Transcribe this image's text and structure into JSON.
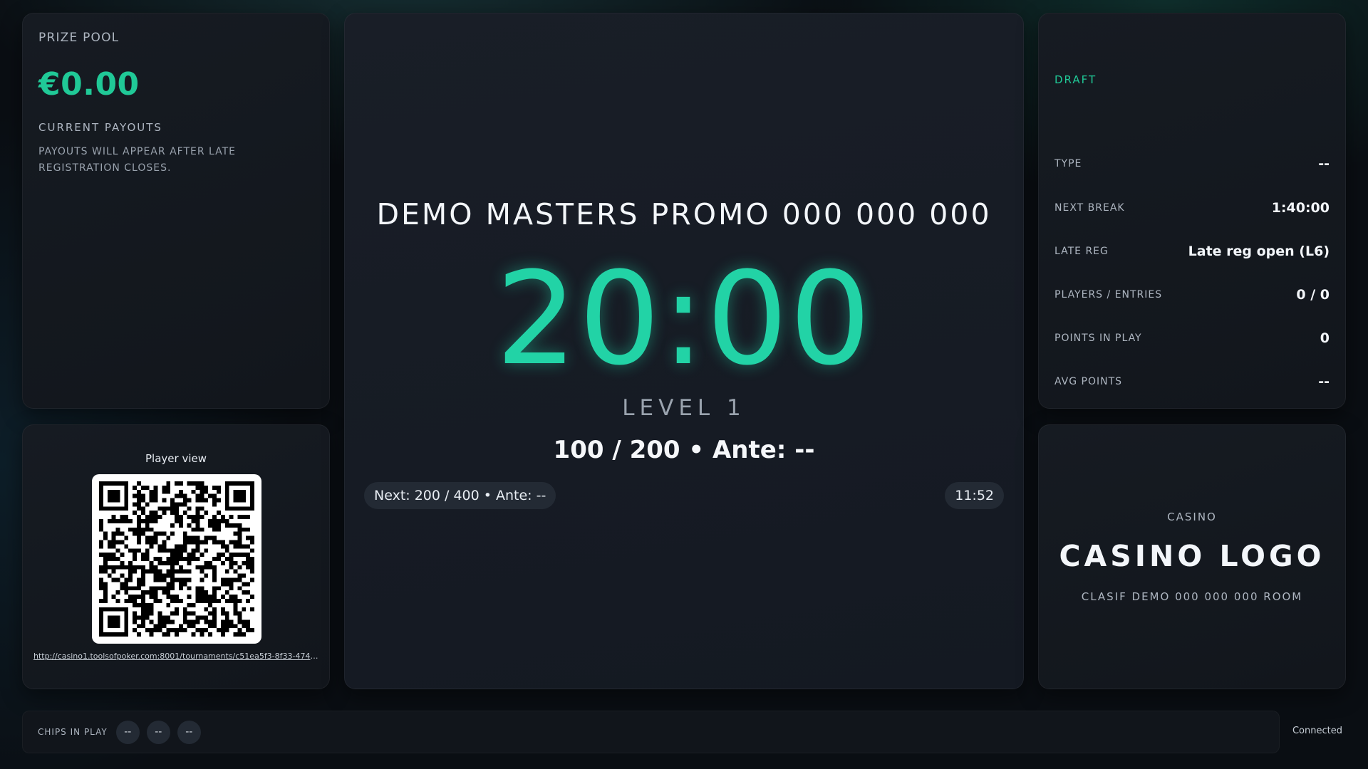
{
  "prize_pool": {
    "label": "PRIZE POOL",
    "amount": "€0.00",
    "payouts_label": "CURRENT PAYOUTS",
    "payouts_note": "PAYOUTS WILL APPEAR AFTER LATE REGISTRATION CLOSES."
  },
  "qr": {
    "title": "Player view",
    "link": "http://casino1.toolsofpoker.com:8001/tournaments/c51ea5f3-8f33-474a-a..."
  },
  "center": {
    "title": "DEMO MASTERS PROMO 000 000 000",
    "clock": "20:00",
    "level": "LEVEL 1",
    "blinds": "100 / 200 • Ante: --",
    "next": "Next: 200 / 400 • Ante: --",
    "time": "11:52"
  },
  "info": {
    "status": "DRAFT",
    "rows": [
      {
        "label": "TYPE",
        "value": "--"
      },
      {
        "label": "NEXT BREAK",
        "value": "1:40:00"
      },
      {
        "label": "LATE REG",
        "value": "Late reg open (L6)"
      },
      {
        "label": "PLAYERS / ENTRIES",
        "value": "0 / 0"
      },
      {
        "label": "POINTS IN PLAY",
        "value": "0"
      },
      {
        "label": "AVG POINTS",
        "value": "--"
      }
    ]
  },
  "logo": {
    "small": "CASINO",
    "main": "CASINO LOGO",
    "sub": "CLASIF DEMO 000 000 000 ROOM"
  },
  "chips": {
    "label": "CHIPS IN PLAY",
    "values": [
      "--",
      "--",
      "--"
    ]
  },
  "connection": "Connected",
  "colors": {
    "accent": "#20c997",
    "clock": "#22d3a6",
    "panel": "#161b22",
    "background": "#0a0e13"
  }
}
